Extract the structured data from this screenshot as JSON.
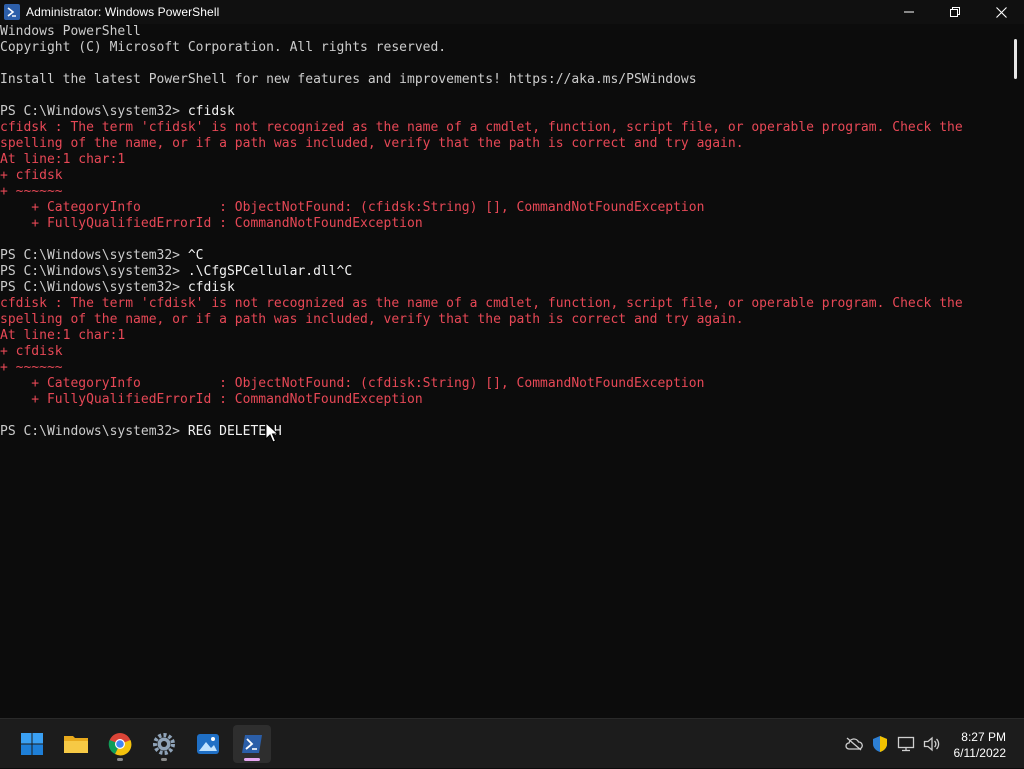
{
  "window": {
    "title": "Administrator: Windows PowerShell",
    "controls": [
      "minimize",
      "restore",
      "close"
    ]
  },
  "console": {
    "lines": [
      {
        "text": "Windows PowerShell",
        "style": "gray"
      },
      {
        "text": "Copyright (C) Microsoft Corporation. All rights reserved.",
        "style": "gray"
      },
      {
        "text": "",
        "style": "gray"
      },
      {
        "text": "Install the latest PowerShell for new features and improvements! https://aka.ms/PSWindows",
        "style": "gray"
      },
      {
        "text": "",
        "style": "gray"
      },
      {
        "prompt": "PS C:\\Windows\\system32> ",
        "cmd": "cfidsk"
      },
      {
        "text": "cfidsk : The term 'cfidsk' is not recognized as the name of a cmdlet, function, script file, or operable program. Check the",
        "style": "err"
      },
      {
        "text": "spelling of the name, or if a path was included, verify that the path is correct and try again.",
        "style": "err"
      },
      {
        "text": "At line:1 char:1",
        "style": "err"
      },
      {
        "text": "+ cfidsk",
        "style": "err"
      },
      {
        "text": "+ ~~~~~~",
        "style": "err"
      },
      {
        "text": "    + CategoryInfo          : ObjectNotFound: (cfidsk:String) [], CommandNotFoundException",
        "style": "err"
      },
      {
        "text": "    + FullyQualifiedErrorId : CommandNotFoundException",
        "style": "err"
      },
      {
        "text": "",
        "style": "gray"
      },
      {
        "prompt": "PS C:\\Windows\\system32> ",
        "cmd": "^C"
      },
      {
        "prompt": "PS C:\\Windows\\system32> ",
        "cmd": ".\\CfgSPCellular.dll^C"
      },
      {
        "prompt": "PS C:\\Windows\\system32> ",
        "cmd": "cfdisk"
      },
      {
        "text": "cfdisk : The term 'cfdisk' is not recognized as the name of a cmdlet, function, script file, or operable program. Check the",
        "style": "err"
      },
      {
        "text": "spelling of the name, or if a path was included, verify that the path is correct and try again.",
        "style": "err"
      },
      {
        "text": "At line:1 char:1",
        "style": "err"
      },
      {
        "text": "+ cfdisk",
        "style": "err"
      },
      {
        "text": "+ ~~~~~~",
        "style": "err"
      },
      {
        "text": "    + CategoryInfo          : ObjectNotFound: (cfdisk:String) [], CommandNotFoundException",
        "style": "err"
      },
      {
        "text": "    + FullyQualifiedErrorId : CommandNotFoundException",
        "style": "err"
      },
      {
        "text": "",
        "style": "gray"
      },
      {
        "prompt": "PS C:\\Windows\\system32> ",
        "cmd": "REG DELETE H"
      }
    ]
  },
  "colors": {
    "background": "#0c0c0c",
    "text": "#cccccc",
    "error": "#e74856",
    "command": "#f2f2f2"
  },
  "taskbar": {
    "apps": [
      {
        "name": "start",
        "icon": "windows-start-icon"
      },
      {
        "name": "file-explorer",
        "icon": "folder-icon"
      },
      {
        "name": "chrome",
        "icon": "chrome-icon"
      },
      {
        "name": "settings",
        "icon": "gear-icon"
      },
      {
        "name": "photos",
        "icon": "photos-icon"
      },
      {
        "name": "powershell",
        "icon": "powershell-icon",
        "active": true
      }
    ],
    "tray": [
      "cloud-off-icon",
      "security-shield-icon",
      "network-icon",
      "volume-icon"
    ],
    "clock": {
      "time": "8:27 PM",
      "date": "6/11/2022"
    }
  }
}
